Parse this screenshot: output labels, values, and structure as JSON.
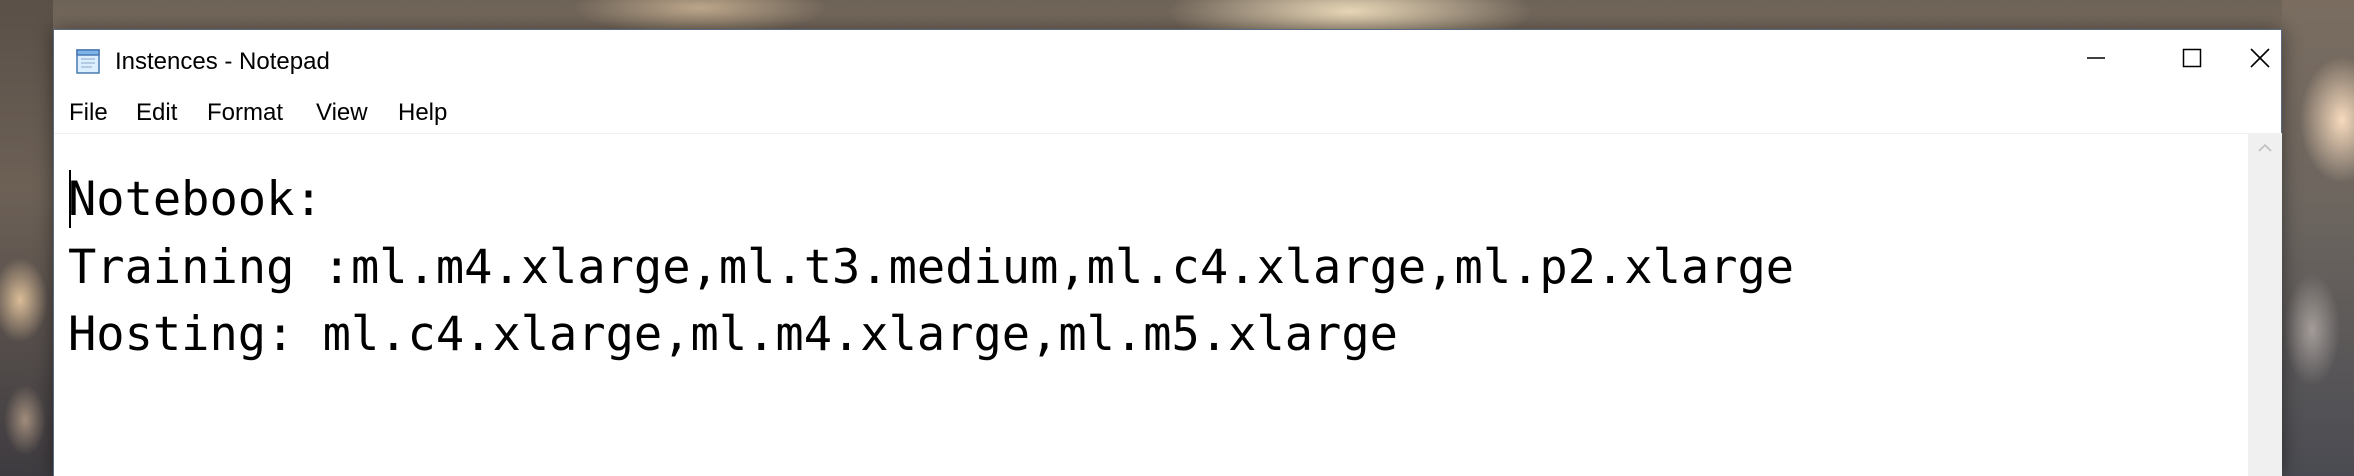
{
  "window": {
    "title": "Instences - Notepad",
    "app_icon": "notepad-icon"
  },
  "caption_buttons": {
    "minimize_icon": "minimize-icon",
    "maximize_icon": "maximize-icon",
    "close_icon": "close-icon"
  },
  "menu": {
    "items": [
      "File",
      "Edit",
      "Format",
      "View",
      "Help"
    ]
  },
  "editor": {
    "lines": [
      "Notebook:",
      "Training :ml.m4.xlarge,ml.t3.medium,ml.c4.xlarge,ml.p2.xlarge",
      "Hosting: ml.c4.xlarge,ml.m4.xlarge,ml.m5.xlarge"
    ]
  },
  "scrollbar": {
    "up_icon": "scroll-up-arrow-icon"
  },
  "colors": {
    "window_border": "#5a6b82",
    "text": "#000000",
    "background": "#ffffff"
  }
}
